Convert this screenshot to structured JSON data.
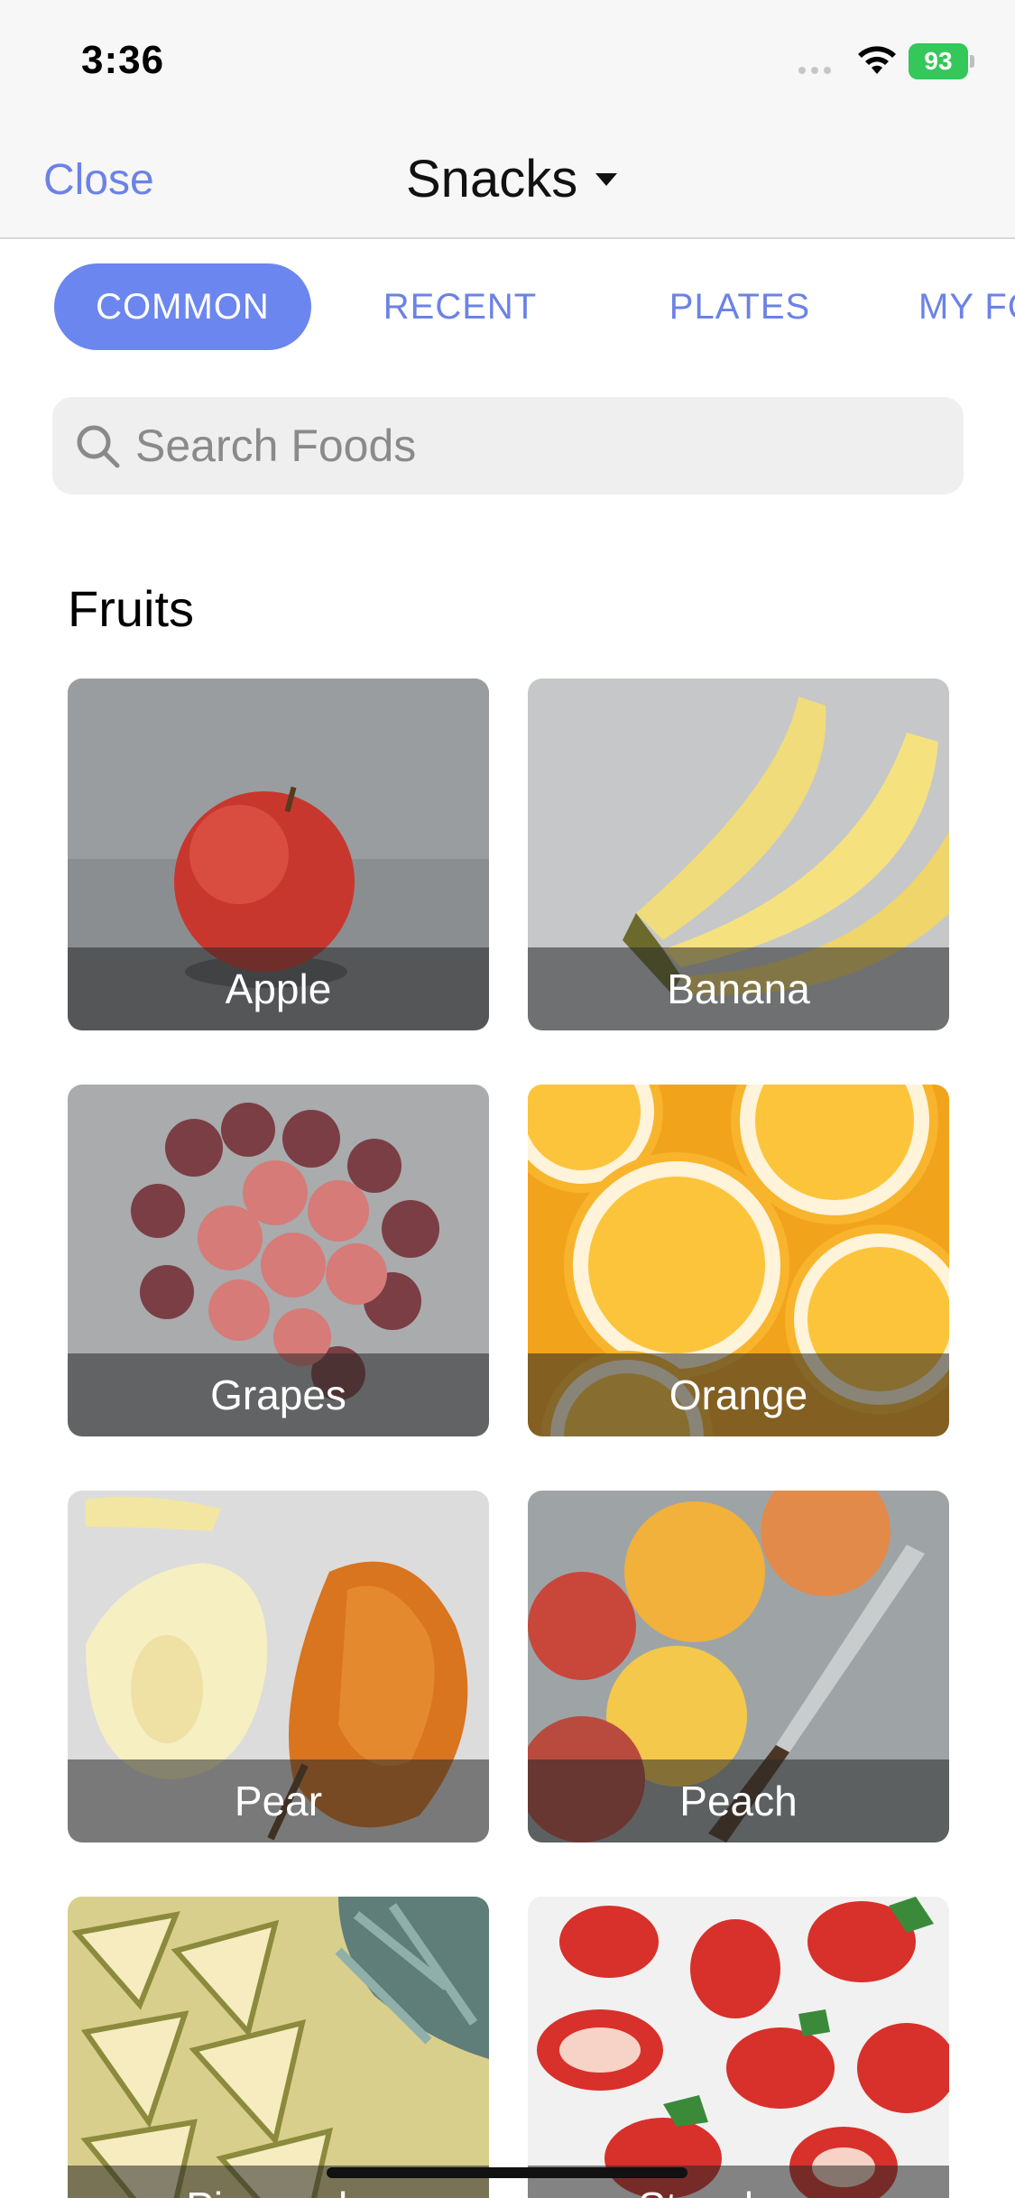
{
  "status_bar": {
    "time": "3:36",
    "battery": "93"
  },
  "nav": {
    "close_label": "Close",
    "title": "Snacks"
  },
  "tabs": [
    {
      "label": "COMMON",
      "active": true
    },
    {
      "label": "RECENT",
      "active": false
    },
    {
      "label": "PLATES",
      "active": false
    },
    {
      "label": "MY FO",
      "active": false
    }
  ],
  "search": {
    "placeholder": "Search Foods"
  },
  "section": {
    "title": "Fruits"
  },
  "foods": [
    {
      "label": "Apple"
    },
    {
      "label": "Banana"
    },
    {
      "label": "Grapes"
    },
    {
      "label": "Orange"
    },
    {
      "label": "Pear"
    },
    {
      "label": "Peach"
    },
    {
      "label": "Pineapple"
    },
    {
      "label": "Strawberry"
    }
  ],
  "colors": {
    "accent": "#6c86ef",
    "link": "#6b82e6",
    "battery": "#34c759"
  }
}
